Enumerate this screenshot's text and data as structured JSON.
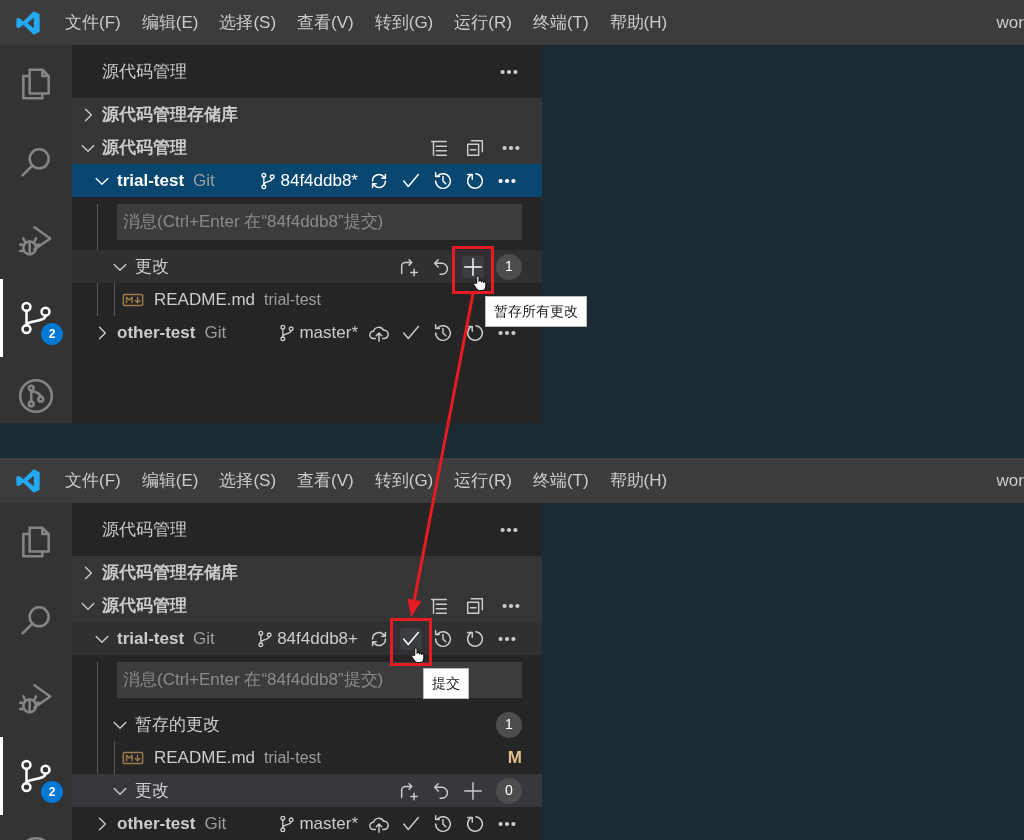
{
  "screens": [
    {
      "menu": [
        "文件(F)",
        "编辑(E)",
        "选择(S)",
        "查看(V)",
        "转到(G)",
        "运行(R)",
        "终端(T)",
        "帮助(H)"
      ],
      "title": "wor",
      "activity_bar": [
        {
          "kind": "files",
          "selected": false
        },
        {
          "kind": "search",
          "selected": false
        },
        {
          "kind": "debug",
          "selected": false
        },
        {
          "kind": "scm",
          "selected": true,
          "badge": "2"
        },
        {
          "kind": "remote",
          "selected": false
        }
      ],
      "sidebar": {
        "title": "源代码管理",
        "sections": [
          {
            "label": "源代码管理存储库",
            "expanded": false
          },
          {
            "label": "源代码管理",
            "expanded": true,
            "actions": [
              {
                "kind": "tree"
              },
              {
                "kind": "collapse"
              },
              {
                "kind": "more"
              }
            ]
          }
        ],
        "repos": [
          {
            "name": "trial-test",
            "provider": "Git",
            "branch": "84f4ddb8*",
            "sync": {
              "kind": "sync"
            },
            "expanded": true,
            "selected": true,
            "hovered": false,
            "actions": [
              {
                "kind": "commit",
                "highlighted": false
              },
              {
                "kind": "history",
                "highlighted": false
              },
              {
                "kind": "refresh",
                "highlighted": false
              },
              {
                "kind": "more",
                "highlighted": false
              }
            ],
            "message_placeholder": "消息(Ctrl+Enter 在“84f4ddb8”提交)",
            "groups": [
              {
                "label": "更改",
                "expanded": true,
                "selected": false,
                "hovered": true,
                "count": "1",
                "actions": [
                  {
                    "kind": "open",
                    "highlighted": false
                  },
                  {
                    "kind": "discard",
                    "highlighted": false
                  },
                  {
                    "kind": "stage",
                    "highlighted": true,
                    "tooltip": "暂存所有更改"
                  }
                ],
                "files": [
                  {
                    "name": "README.md",
                    "path": "trial-test"
                  }
                ]
              }
            ]
          },
          {
            "name": "other-test",
            "provider": "Git",
            "branch": "master*",
            "sync": {
              "kind": "publish"
            },
            "expanded": false,
            "selected": false,
            "hovered": false,
            "actions": [
              {
                "kind": "commit",
                "highlighted": false
              },
              {
                "kind": "history",
                "highlighted": false
              },
              {
                "kind": "refresh",
                "highlighted": false
              },
              {
                "kind": "more",
                "highlighted": false
              }
            ]
          }
        ]
      }
    },
    {
      "menu": [
        "文件(F)",
        "编辑(E)",
        "选择(S)",
        "查看(V)",
        "转到(G)",
        "运行(R)",
        "终端(T)",
        "帮助(H)"
      ],
      "title": "wor",
      "activity_bar": [
        {
          "kind": "files",
          "selected": false
        },
        {
          "kind": "search",
          "selected": false
        },
        {
          "kind": "debug",
          "selected": false
        },
        {
          "kind": "scm",
          "selected": true,
          "badge": "2"
        },
        {
          "kind": "remote",
          "selected": false
        }
      ],
      "sidebar": {
        "title": "源代码管理",
        "sections": [
          {
            "label": "源代码管理存储库",
            "expanded": false
          },
          {
            "label": "源代码管理",
            "expanded": true,
            "actions": [
              {
                "kind": "tree"
              },
              {
                "kind": "collapse"
              },
              {
                "kind": "more"
              }
            ]
          }
        ],
        "repos": [
          {
            "name": "trial-test",
            "provider": "Git",
            "branch": "84f4ddb8+",
            "sync": {
              "kind": "sync"
            },
            "expanded": true,
            "selected": false,
            "hovered": true,
            "actions": [
              {
                "kind": "commit",
                "highlighted": true,
                "tooltip": "提交"
              },
              {
                "kind": "history",
                "highlighted": false
              },
              {
                "kind": "refresh",
                "highlighted": false
              },
              {
                "kind": "more",
                "highlighted": false
              }
            ],
            "message_placeholder": "消息(Ctrl+Enter 在“84f4ddb8”提交)",
            "groups": [
              {
                "label": "暂存的更改",
                "expanded": true,
                "selected": false,
                "hovered": false,
                "count": "1",
                "files": [
                  {
                    "name": "README.md",
                    "path": "trial-test",
                    "status": "M"
                  }
                ]
              },
              {
                "label": "更改",
                "expanded": true,
                "selected": true,
                "hovered": false,
                "count": "0",
                "actions": [
                  {
                    "kind": "open",
                    "highlighted": false
                  },
                  {
                    "kind": "discard",
                    "highlighted": false
                  },
                  {
                    "kind": "stage",
                    "highlighted": false
                  }
                ]
              }
            ]
          },
          {
            "name": "other-test",
            "provider": "Git",
            "branch": "master*",
            "sync": {
              "kind": "publish"
            },
            "expanded": false,
            "selected": false,
            "hovered": false,
            "actions": [
              {
                "kind": "commit",
                "highlighted": false
              },
              {
                "kind": "history",
                "highlighted": false
              },
              {
                "kind": "refresh",
                "highlighted": false
              },
              {
                "kind": "more",
                "highlighted": false
              }
            ]
          }
        ]
      }
    }
  ]
}
